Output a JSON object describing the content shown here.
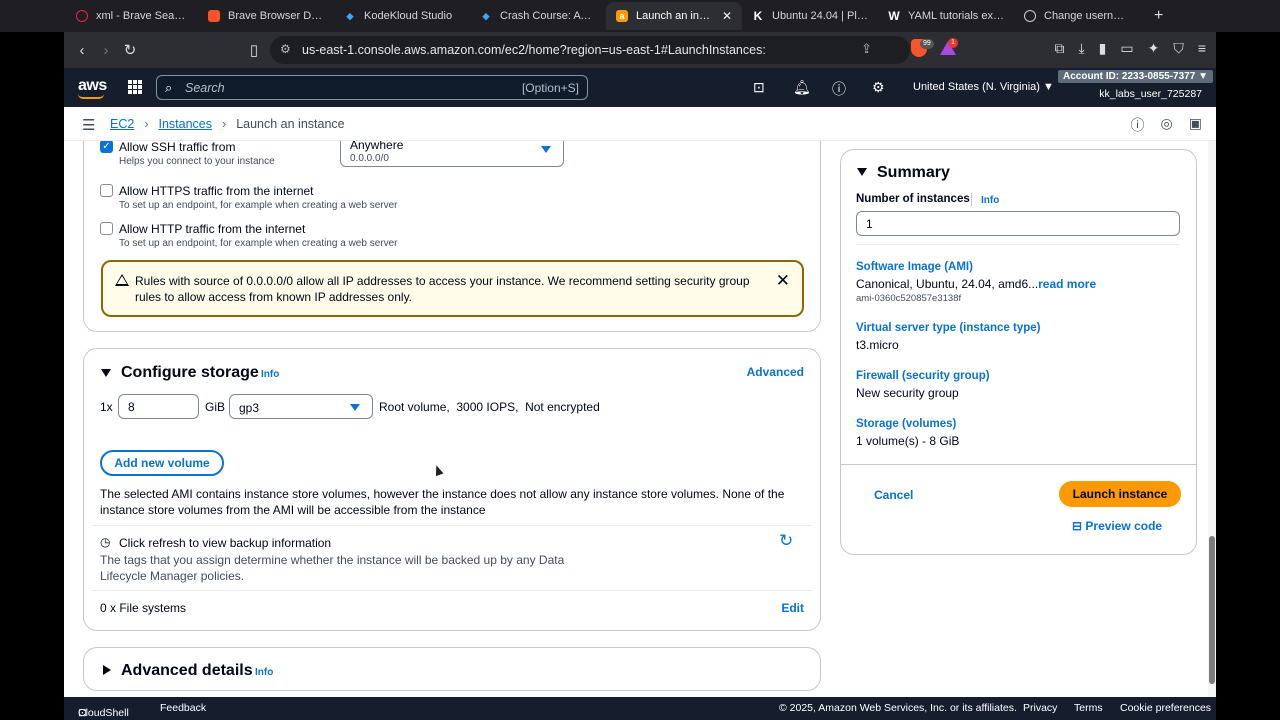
{
  "browser": {
    "tabs": [
      {
        "label": "xml - Brave Search",
        "icon": "brave-search-icon",
        "color": "#e24"
      },
      {
        "label": "Brave Browser Down",
        "icon": "brave-icon",
        "color": "#fb542b"
      },
      {
        "label": "KodeKloud Studio",
        "icon": "kodekloud-icon",
        "color": "#3aa7ff"
      },
      {
        "label": "Crash Course: AWS B",
        "icon": "kodekloud-icon",
        "color": "#3aa7ff"
      },
      {
        "label": "Launch an instan",
        "icon": "aws-icon",
        "color": "#ff9900",
        "active": true
      },
      {
        "label": "Ubuntu 24.04 | Playg",
        "icon": "k-icon",
        "color": "#fff"
      },
      {
        "label": "YAML tutorials examp",
        "icon": "w-icon",
        "color": "#fff"
      },
      {
        "label": "Change username in",
        "icon": "globe-icon",
        "color": "#fff"
      }
    ],
    "url": "us-east-1.console.aws.amazon.com/ec2/home?region=us-east-1#LaunchInstances:",
    "shield_count": "99",
    "rewards_count": "1"
  },
  "aws_header": {
    "search_placeholder": "Search",
    "search_shortcut": "[Option+S]",
    "region": "United States (N. Virginia) ▼",
    "account": "Account ID: 2233-0855-7377 ▼",
    "user": "kk_labs_user_725287"
  },
  "breadcrumb": {
    "items": [
      "EC2",
      "Instances"
    ],
    "current": "Launch an instance"
  },
  "network": {
    "ssh_label": "Allow SSH traffic from",
    "ssh_sub": "Helps you connect to your instance",
    "ssh_source": "Anywhere",
    "ssh_source_sub": "0.0.0.0/0",
    "https_label": "Allow HTTPS traffic from the internet",
    "https_sub": "To set up an endpoint, for example when creating a web server",
    "http_label": "Allow HTTP traffic from the internet",
    "http_sub": "To set up an endpoint, for example when creating a web server",
    "warning": "Rules with source of 0.0.0.0/0 allow all IP addresses to access your instance. We recommend setting security group rules to allow access from known IP addresses only."
  },
  "storage": {
    "title": "Configure storage",
    "info": "Info",
    "advanced": "Advanced",
    "multiplier": "1x",
    "size": "8",
    "unit": "GiB",
    "volume_type": "gp3",
    "volume_desc": "Root volume,  3000 IOPS,  Not encrypted",
    "add_volume": "Add new volume",
    "ami_note": "The selected AMI contains instance store volumes, however the instance does not allow any instance store volumes. None of the instance store volumes from the AMI will be accessible from the instance",
    "backup_title": "Click refresh to view backup information",
    "backup_desc": "The tags that you assign determine whether the instance will be backed up by any Data Lifecycle Manager policies.",
    "fs_label": "0 x File systems",
    "fs_edit": "Edit"
  },
  "advanced_details": {
    "title": "Advanced details",
    "info": "Info"
  },
  "summary": {
    "title": "Summary",
    "num_label": "Number of instances",
    "num_info": "Info",
    "num_value": "1",
    "ami_label": "Software Image (AMI)",
    "ami_value": "Canonical, Ubuntu, 24.04, amd6...",
    "ami_readmore": "read more",
    "ami_id": "ami-0360c520857e3138f",
    "type_label": "Virtual server type (instance type)",
    "type_value": "t3.micro",
    "fw_label": "Firewall (security group)",
    "fw_value": "New security group",
    "storage_label": "Storage (volumes)",
    "storage_value": "1 volume(s) - 8 GiB",
    "cancel": "Cancel",
    "launch": "Launch instance",
    "preview": "Preview code"
  },
  "footer": {
    "cloudshell": "CloudShell",
    "feedback": "Feedback",
    "copyright": "© 2025, Amazon Web Services, Inc. or its affiliates.",
    "privacy": "Privacy",
    "terms": "Terms",
    "cookies": "Cookie preferences"
  }
}
